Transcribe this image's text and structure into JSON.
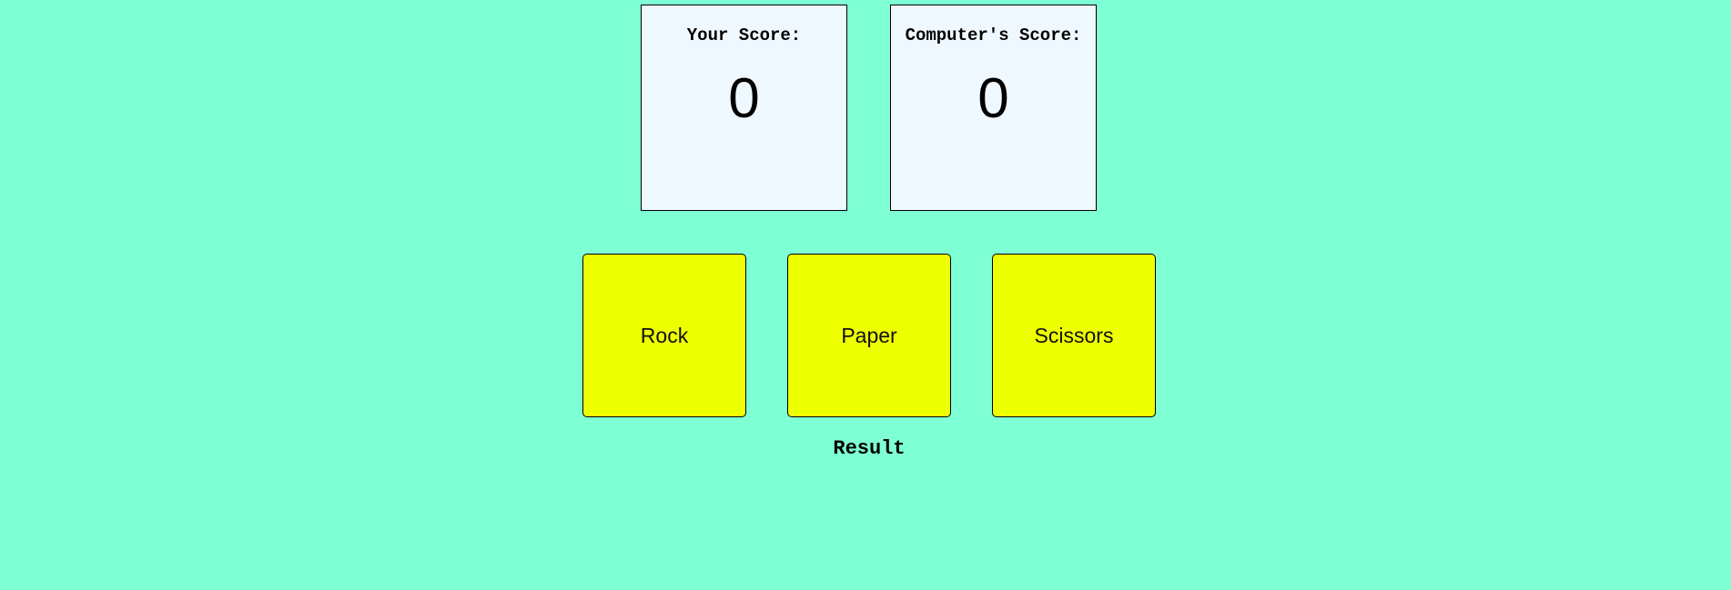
{
  "colors": {
    "background": "#7fffd4",
    "score_card": "#f0f8ff",
    "button": "#eeff00"
  },
  "scoreboard": {
    "player": {
      "label": "Your Score:",
      "value": "0"
    },
    "computer": {
      "label": "Computer's Score:",
      "value": "0"
    }
  },
  "choices": {
    "rock": "Rock",
    "paper": "Paper",
    "scissors": "Scissors"
  },
  "result": "Result"
}
